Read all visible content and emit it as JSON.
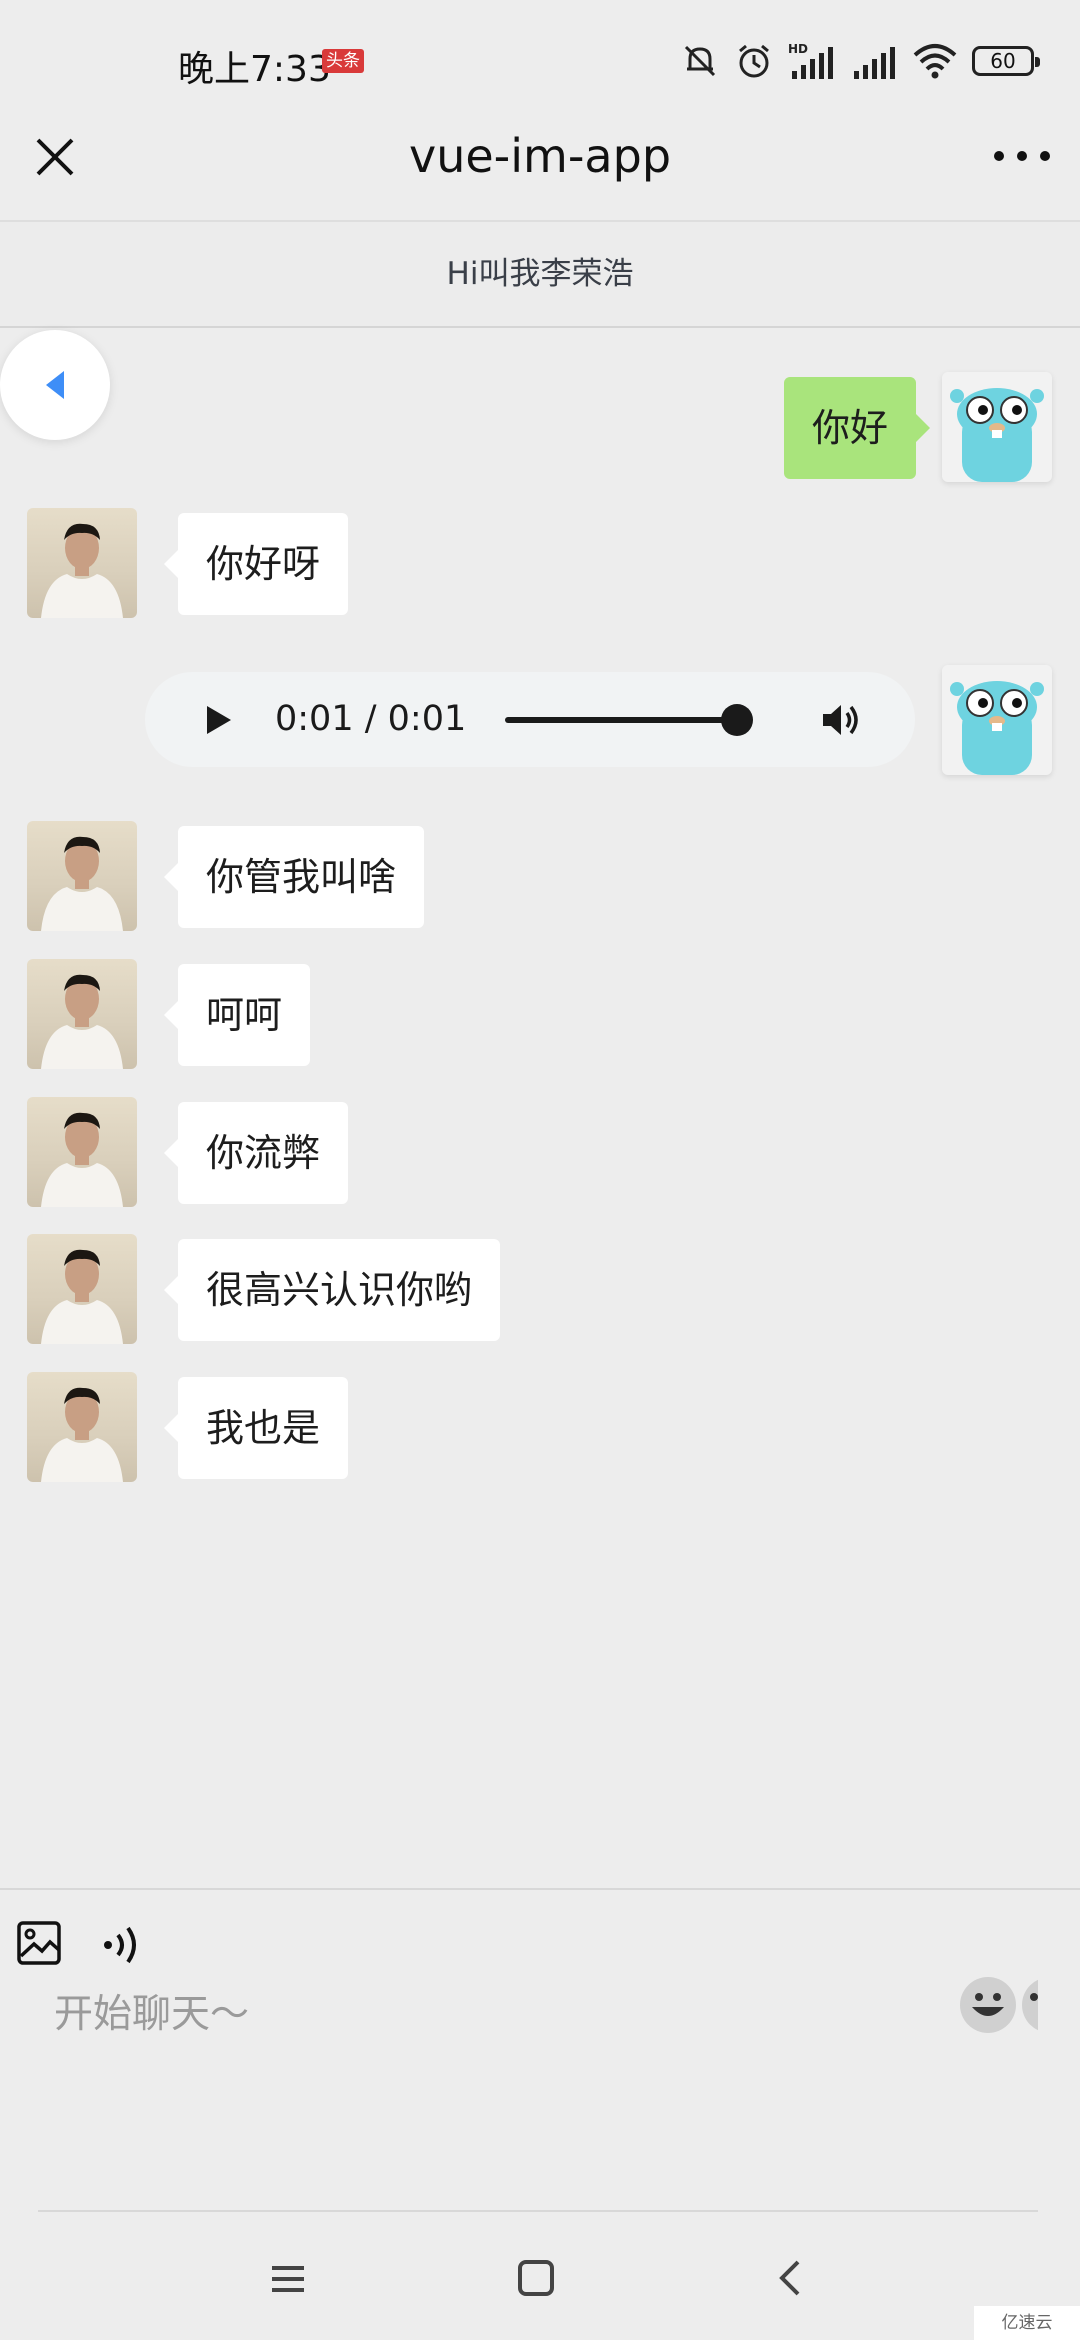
{
  "status_bar": {
    "time": "晚上7:33",
    "badge": "头条",
    "network_label": "HD",
    "battery": "60"
  },
  "nav": {
    "title": "vue-im-app"
  },
  "chat": {
    "header": "Hi叫我李荣浩"
  },
  "messages": [
    {
      "side": "right",
      "type": "text",
      "text": "你好"
    },
    {
      "side": "left",
      "type": "text",
      "text": "你好呀"
    },
    {
      "side": "right",
      "type": "audio",
      "time": "0:01 / 0:01",
      "progress": 1.0
    },
    {
      "side": "left",
      "type": "text",
      "text": "你管我叫啥"
    },
    {
      "side": "left",
      "type": "text",
      "text": "呵呵"
    },
    {
      "side": "left",
      "type": "text",
      "text": "你流弊"
    },
    {
      "side": "left",
      "type": "text",
      "text": "很高兴认识你哟"
    },
    {
      "side": "left",
      "type": "text",
      "text": "我也是"
    }
  ],
  "input": {
    "placeholder": "开始聊天～",
    "value": ""
  },
  "watermark": "亿速云",
  "colors": {
    "background": "#ededed",
    "sent_bubble": "#a9e47c",
    "received_bubble": "#ffffff",
    "back_arrow": "#3e8ef7"
  },
  "icons": {
    "close": "close-icon",
    "more": "more-icon",
    "back": "back-arrow-icon",
    "image": "image-icon",
    "voice": "voice-icon",
    "emoji": "emoji-icon"
  }
}
